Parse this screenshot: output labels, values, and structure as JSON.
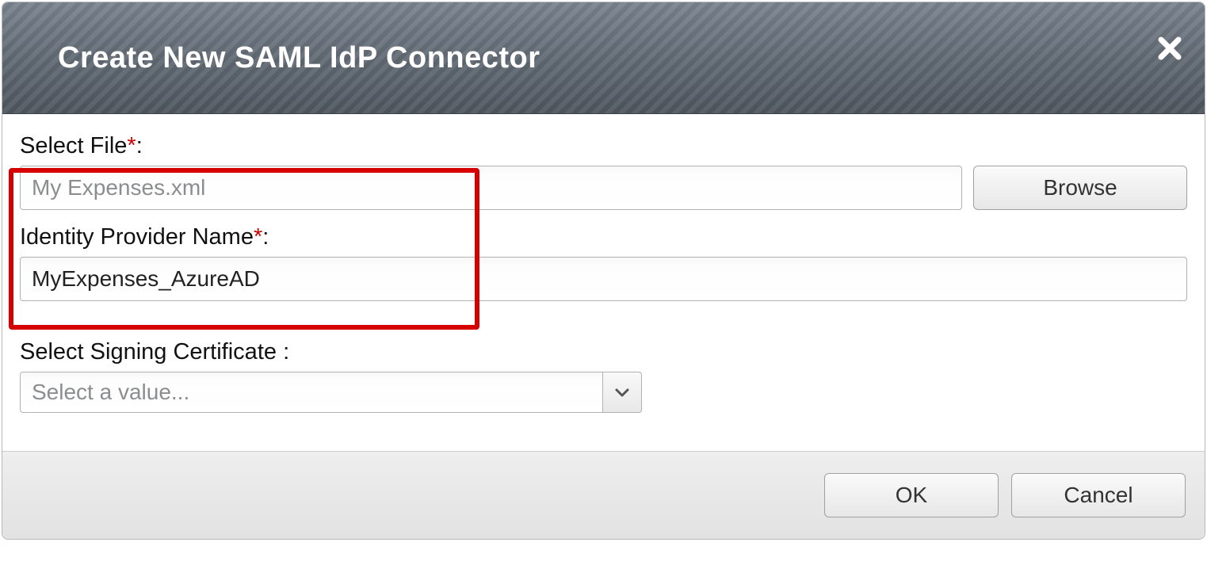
{
  "dialog": {
    "title": "Create New SAML IdP Connector",
    "close_icon": "close-icon"
  },
  "fields": {
    "select_file": {
      "label": "Select File",
      "required": true,
      "value": "My Expenses.xml",
      "browse_label": "Browse"
    },
    "idp_name": {
      "label": "Identity Provider Name",
      "required": true,
      "value": "MyExpenses_AzureAD"
    },
    "signing_cert": {
      "label": "Select Signing Certificate",
      "required": false,
      "placeholder": "Select a value..."
    }
  },
  "footer": {
    "ok_label": "OK",
    "cancel_label": "Cancel"
  }
}
